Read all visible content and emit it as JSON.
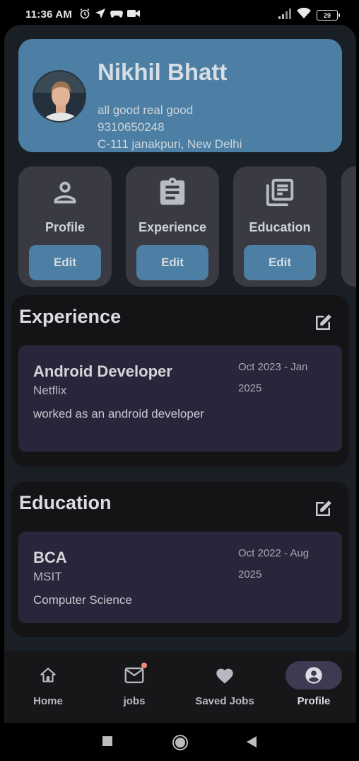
{
  "status_bar": {
    "time": "11:36 AM",
    "battery": "29",
    "left_icons": [
      "alarm-icon",
      "send-icon",
      "game-controller-icon",
      "video-camera-icon"
    ],
    "right_icons": [
      "signal-icon",
      "wifi-icon",
      "battery-icon"
    ]
  },
  "profile": {
    "name": "Nikhil Bhatt",
    "tagline": "all good real good",
    "phone": "9310650248",
    "address": "C-111 janakpuri, New Delhi"
  },
  "tiles": [
    {
      "title": "Profile",
      "icon": "person-icon",
      "button": "Edit"
    },
    {
      "title": "Experience",
      "icon": "clipboard-icon",
      "button": "Edit"
    },
    {
      "title": "Education",
      "icon": "library-books-icon",
      "button": "Edit"
    }
  ],
  "experience": {
    "heading": "Experience",
    "items": [
      {
        "title": "Android Developer",
        "organization": "Netflix",
        "dates": "Oct 2023 - Jan 2025",
        "description": "worked as an android developer"
      }
    ]
  },
  "education": {
    "heading": "Education",
    "items": [
      {
        "title": "BCA",
        "organization": "MSIT",
        "dates": "Oct 2022 - Aug 2025",
        "description": "Computer Science"
      }
    ]
  },
  "bottom_nav": {
    "active": "Profile",
    "items": [
      {
        "label": "Home",
        "icon": "home-icon"
      },
      {
        "label": "jobs",
        "icon": "mail-icon",
        "badge": true
      },
      {
        "label": "Saved Jobs",
        "icon": "heart-icon"
      },
      {
        "label": "Profile",
        "icon": "account-circle-icon"
      }
    ]
  },
  "colors": {
    "accent": "#4c7fa3",
    "background": "#1a1f26",
    "card": "#3a3a42",
    "entry_card": "#29253a",
    "badge": "#f08a7c"
  }
}
